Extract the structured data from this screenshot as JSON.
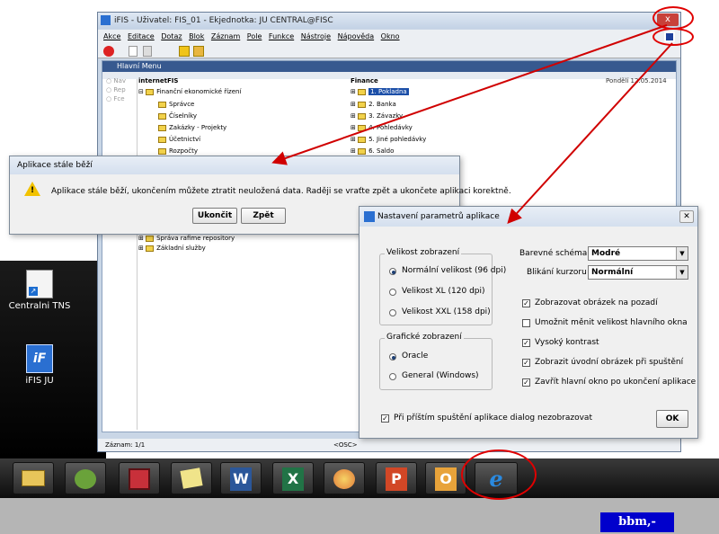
{
  "desktop": {
    "icons": [
      {
        "label": "Centralni TNS",
        "icon": "shortcut-icon"
      },
      {
        "label": "iFIS JU",
        "icon": "ifis-app-icon"
      }
    ]
  },
  "taskbar": {
    "items": [
      "file-explorer-icon",
      "frog-app-icon",
      "floppy-save-icon",
      "sticky-notes-icon",
      "word-icon",
      "excel-icon",
      "paint-icon",
      "powerpoint-icon",
      "outlook-icon",
      "internet-explorer-icon"
    ]
  },
  "footer": {
    "brand": "bbm,-"
  },
  "main_window": {
    "title": "iFIS - Uživatel: FIS_01 - Ekjednotka: JU CENTRAL@FISC",
    "close_label": "x",
    "menu": [
      "Akce",
      "Editace",
      "Dotaz",
      "Blok",
      "Záznam",
      "Pole",
      "Funkce",
      "Nástroje",
      "Nápověda",
      "Okno"
    ],
    "hlavni_menu": {
      "title": "Hlavní Menu",
      "left_options": [
        "Nav",
        "Rep",
        "Fce"
      ],
      "left_header": "internetFIS",
      "left_tree": [
        "Finanční ekonomické řízení",
        "Správce",
        "Číselníky",
        "Zakázky - Projekty",
        "Účetnictví",
        "Rozpočty"
      ],
      "left_tree_bottom": [
        "Správa rafime repository",
        "Základní služby"
      ],
      "right_header": "Finance",
      "date": "Pondělí 12.05.2014",
      "right_tree": [
        "1. Pokladna",
        "2. Banka",
        "3. Závazky",
        "4. Pohledávky",
        "5. Jiné pohledávky",
        "6. Saldo"
      ]
    },
    "status": {
      "record": "Záznam: 1/1",
      "mode": "<OSC>"
    }
  },
  "dialog_running": {
    "title": "Aplikace stále běží",
    "message": "Aplikace stále běží, ukončením můžete ztratit neuložená data. Raději se vraťte zpět a ukončete aplikaci korektně.",
    "btn_quit": "Ukončit",
    "btn_back": "Zpět"
  },
  "dialog_settings": {
    "title": "Nastavení parametrů aplikace",
    "size_group": "Velikost zobrazení",
    "size_options": [
      "Normální velikost (96 dpi)",
      "Velikost XL (120 dpi)",
      "Velikost XXL (158 dpi)"
    ],
    "graphics_group": "Grafické zobrazení",
    "graphics_options": [
      "Oracle",
      "General (Windows)"
    ],
    "scheme_label": "Barevné schéma",
    "scheme_value": "Modré",
    "cursor_label": "Blikání kurzoru",
    "cursor_value": "Normální",
    "checkboxes": [
      {
        "label": "Zobrazovat obrázek na pozadí",
        "checked": true
      },
      {
        "label": "Umožnit měnit velikost hlavního okna",
        "checked": false
      },
      {
        "label": "Vysoký kontrast",
        "checked": true
      },
      {
        "label": "Zobrazit úvodní obrázek při spuštění",
        "checked": true
      },
      {
        "label": "Zavřít hlavní okno po ukončení aplikace",
        "checked": true
      }
    ],
    "no_show_label": "Při příštím spuštění aplikace dialog nezobrazovat",
    "ok": "OK"
  },
  "colors": {
    "annotation": "#e00000",
    "bbm_bg": "#0000cc",
    "title_blue": "#37598f"
  }
}
